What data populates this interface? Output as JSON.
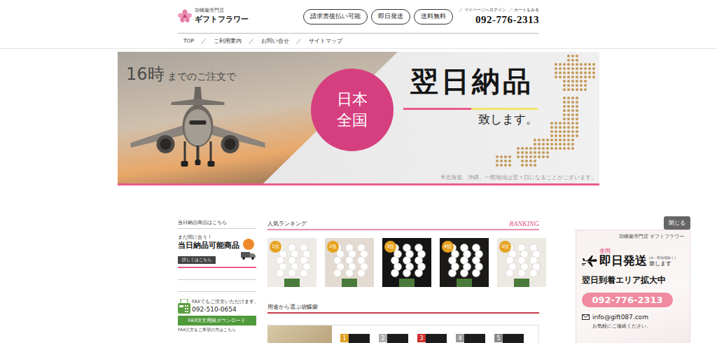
{
  "header": {
    "logo": {
      "category": "胡蝶蘭専門店",
      "name": "ギフトフラワー"
    },
    "badges": [
      "請求書後払い可能",
      "即日発送",
      "送料無料"
    ],
    "links": [
      {
        "sep": "／",
        "label": "マイページへログイン"
      },
      {
        "sep": "／",
        "label": "カートをみる"
      }
    ],
    "phone": "092-776-2313"
  },
  "nav": {
    "items": [
      {
        "label": "TOP"
      },
      {
        "label": "ご利用案内"
      },
      {
        "label": "お問い合せ"
      },
      {
        "label": "サイトマップ"
      }
    ],
    "separator": "／"
  },
  "banner": {
    "hour": "16時",
    "order_text": "までのご注文で",
    "region": [
      "日本",
      "全国"
    ],
    "headline": "翌日納品",
    "suffix": "致します。",
    "note": "※北海道、沖縄、一部地域は翌々日になることがございます。"
  },
  "sidebar": {
    "same_day_title": "当日納品商品はこちら",
    "promo": {
      "kicker": "まだ間に合う！",
      "title": "当日納品可能商品",
      "button": "詳しくはこちら"
    },
    "fax": {
      "lead": "FAXでもご注文いただけます。",
      "number": "092-510-0654",
      "download": "FAX注文用紙ダウンロード",
      "caption": "FAX注文をご希望の方はこちら"
    }
  },
  "ranking": {
    "title": "人気ランキング",
    "label": "RANKING",
    "items": [
      {
        "rank": "1位"
      },
      {
        "rank": "2位"
      },
      {
        "rank": "3位"
      },
      {
        "rank": "4位"
      },
      {
        "rank": "5位"
      }
    ]
  },
  "purpose": {
    "title": "用途から選ぶ胡蝶蘭",
    "items": [
      {
        "number": "1",
        "color": "#e0a020"
      },
      {
        "number": "2",
        "color": "#b0b0b0"
      },
      {
        "number": "3",
        "color": "#d03030"
      },
      {
        "number": "4",
        "color": "#9a9a9a"
      },
      {
        "number": "5",
        "color": "#8a8a8a"
      }
    ]
  },
  "float_ad": {
    "close": "閉じる",
    "shop": "胡蝶蘭専門店 ギフトフラワー",
    "area": "全国",
    "headline": "即日発送",
    "note": "(※一部地域除く)",
    "suffix": "致します",
    "sub": "翌日到着エリア拡大中",
    "phone": "092-776-2313",
    "email": "info@gift087.com",
    "footer": "お気軽にご連絡ください。"
  }
}
